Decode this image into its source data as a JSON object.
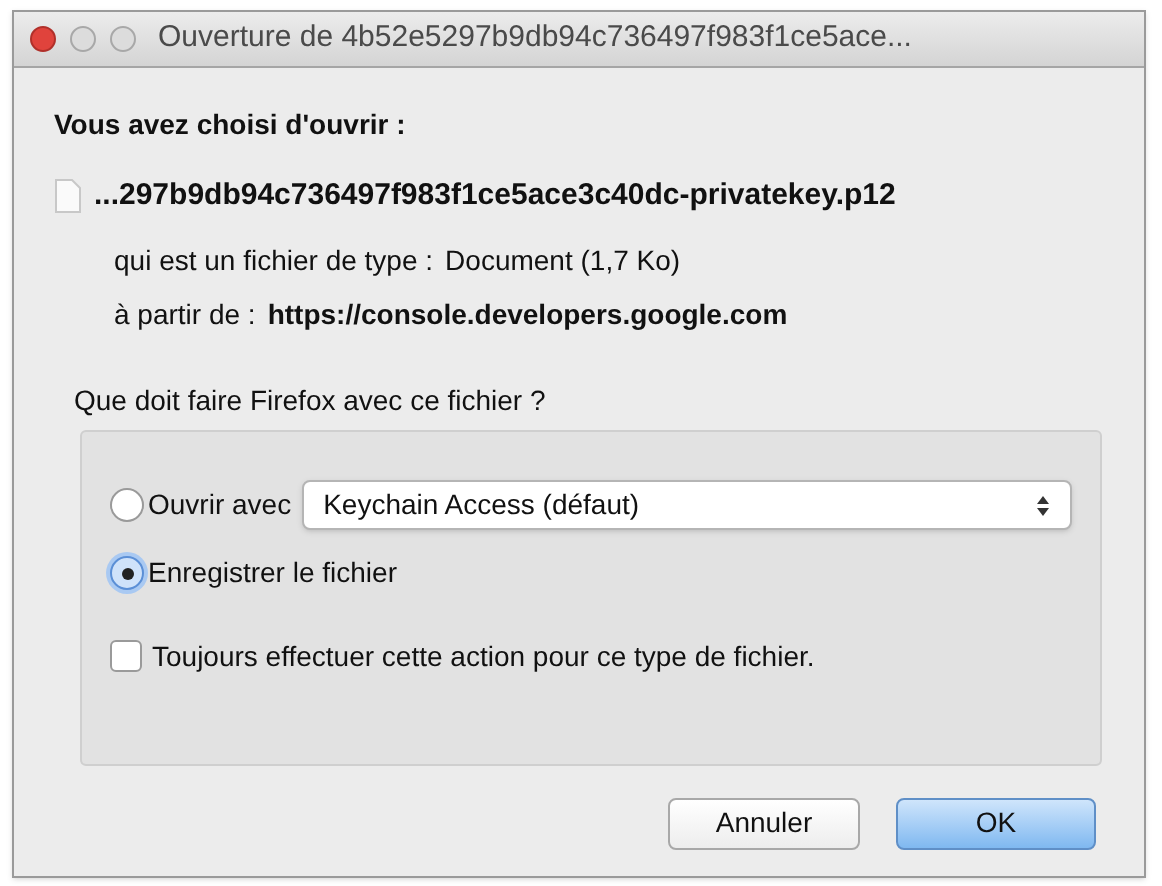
{
  "window": {
    "title": "Ouverture de 4b52e5297b9db94c736497f983f1ce5ace..."
  },
  "heading": "Vous avez choisi d'ouvrir :",
  "file": {
    "name": "...297b9db94c736497f983f1ce5ace3c40dc-privatekey.p12",
    "type_label": "qui est un fichier de type :",
    "type_value": "Document (1,7 Ko)",
    "from_label": "à partir de :",
    "from_value": "https://console.developers.google.com"
  },
  "question": "Que doit faire Firefox avec ce fichier ?",
  "options": [
    {
      "kind": "open-with",
      "label": "Ouvrir avec",
      "selected": false,
      "app": "Keychain Access (défaut)"
    },
    {
      "kind": "plain",
      "label": "Enregistrer le fichier",
      "selected": true
    }
  ],
  "always": {
    "label": "Toujours effectuer cette action pour ce type de fichier.",
    "checked": false
  },
  "buttons": [
    {
      "label": "Annuler",
      "default": false
    },
    {
      "label": "OK",
      "default": true
    }
  ]
}
